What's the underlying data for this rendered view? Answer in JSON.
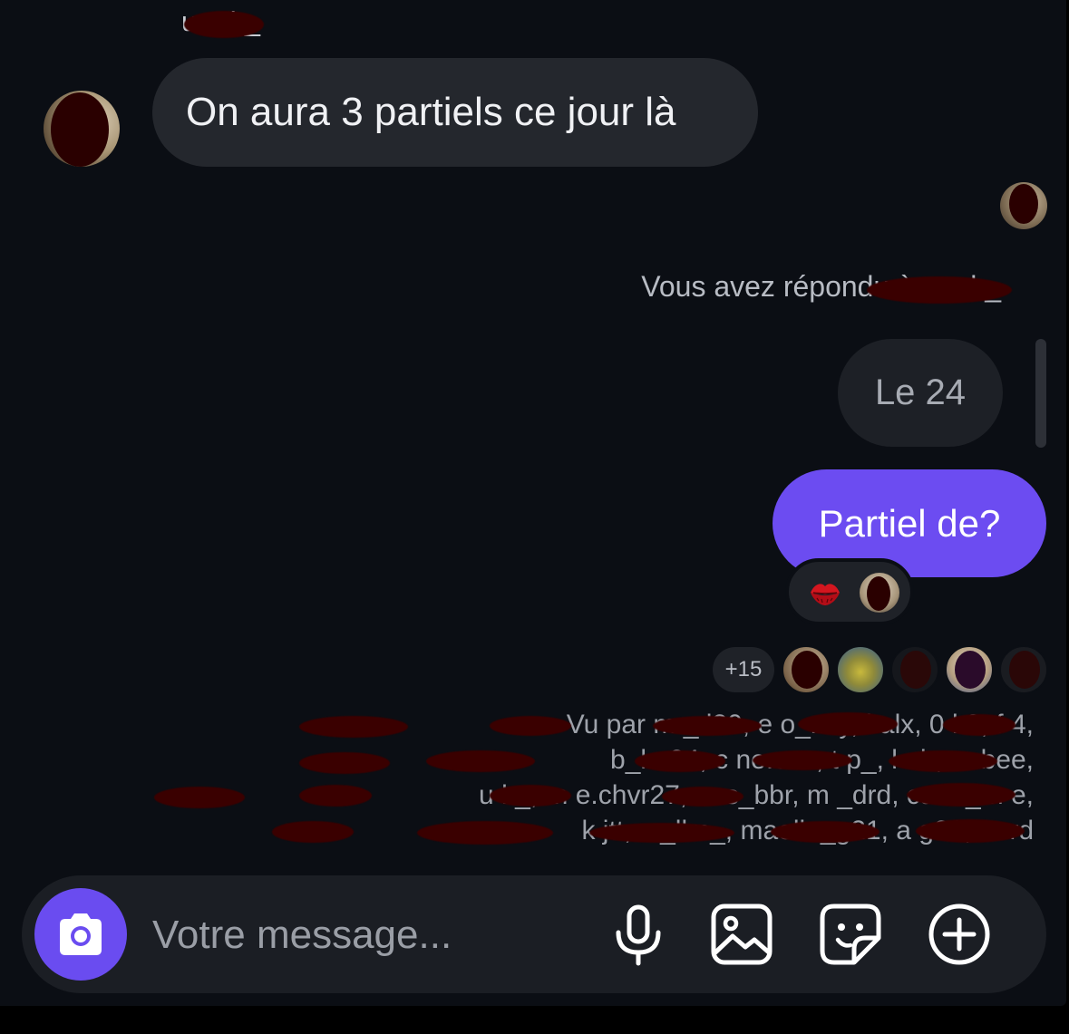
{
  "thread": {
    "sender_name": "u   u.k_",
    "incoming_message": "On aura 3 partiels ce jour là",
    "reply_note": "Vous avez répondu à u   u.k_",
    "quoted_message": "Le 24",
    "outgoing_message": "Partiel de?",
    "reaction": {
      "emoji_icon": "kiss-mark-icon"
    },
    "seen": {
      "extra_count": "+15",
      "list_line_1": "Vu par m    _   l20, e    o_mly, i    alx, 0     k0, f     4,",
      "list_line_2": "b_l   e04, c    ne.ccn, t    p_, l    ah, m     bee,",
      "list_line_3": "u    k_, m   e.chvr27, m    s_bbr, m    _drd, cano_m     e,",
      "list_line_4": "k   jtt, c     _llm_, maelle_g21, a     g26, r    vrd"
    }
  },
  "composer": {
    "placeholder": "Votre message...",
    "value": "",
    "icons": [
      "camera-icon",
      "microphone-icon",
      "image-icon",
      "sticker-icon",
      "plus-circle-icon"
    ]
  },
  "colors": {
    "background": "#0b0e14",
    "incoming_bubble": "#24272d",
    "outgoing_bubble": "#6c4cf1",
    "accent": "#6a4cf0"
  }
}
